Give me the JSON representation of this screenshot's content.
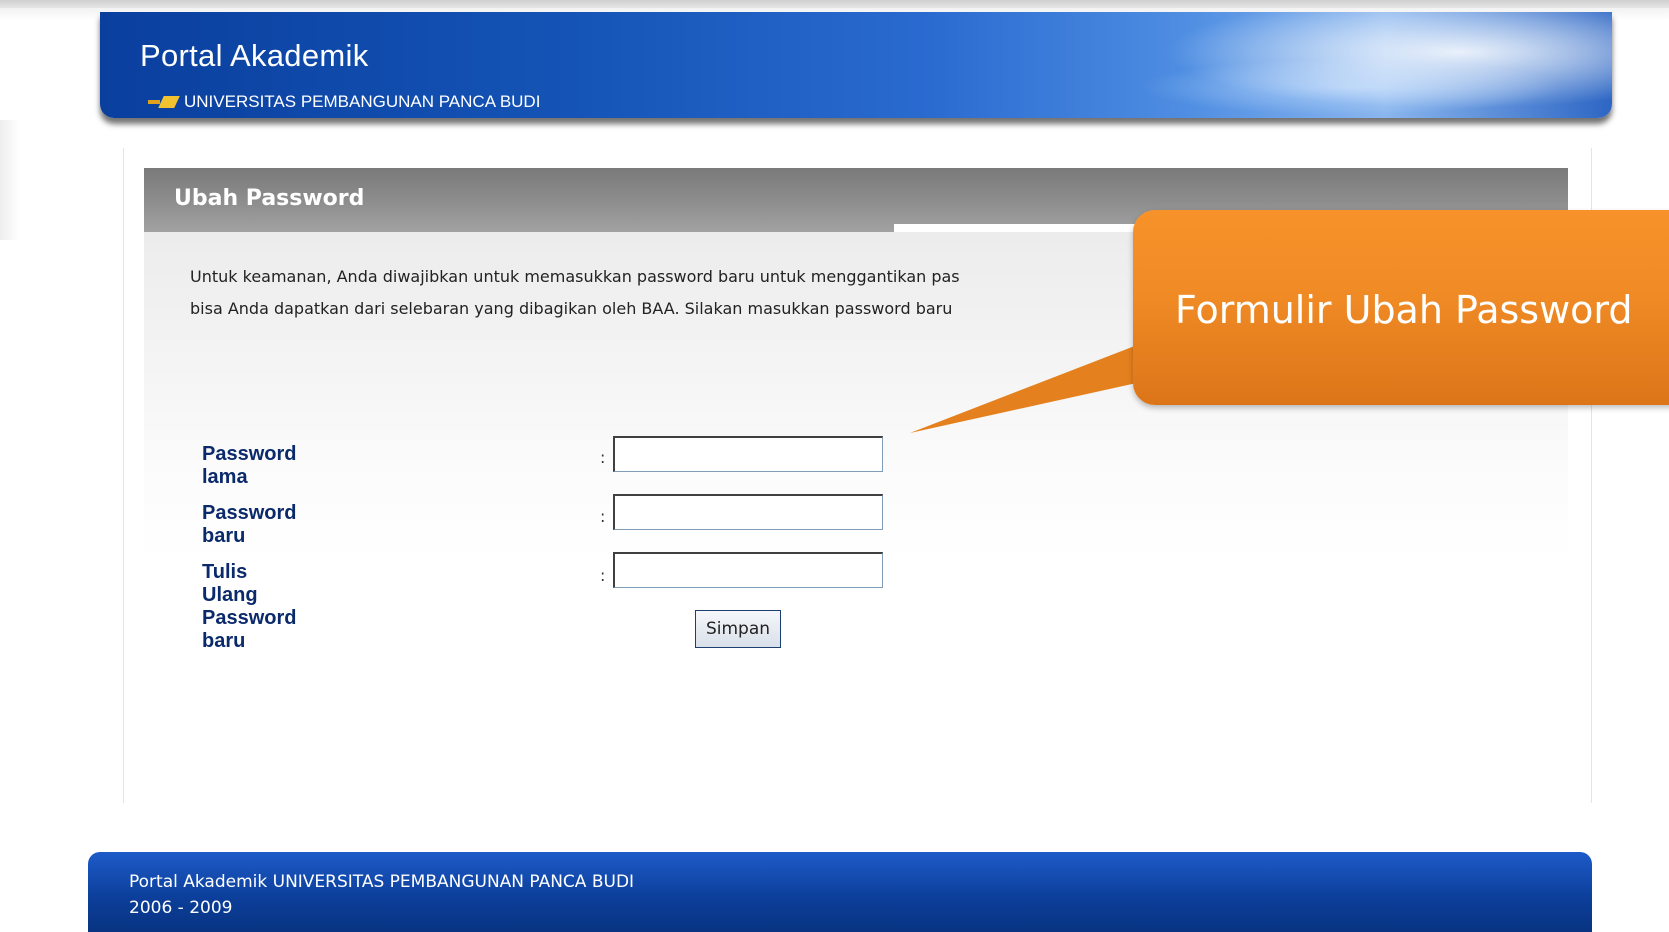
{
  "header": {
    "title": "Portal Akademik",
    "subtitle": "UNIVERSITAS PEMBANGUNAN PANCA BUDI"
  },
  "panel": {
    "title": "Ubah Password",
    "intro_line1": "Untuk keamanan, Anda diwajibkan untuk memasukkan password baru untuk menggantikan pas",
    "intro_line2": "bisa Anda dapatkan dari selebaran yang dibagikan oleh BAA. Silakan masukkan password baru"
  },
  "form": {
    "fields": [
      {
        "label": "Password lama",
        "colon": ":",
        "value": ""
      },
      {
        "label": "Password baru",
        "colon": ":",
        "value": ""
      },
      {
        "label": "Tulis Ulang Password baru",
        "colon": ":",
        "value": ""
      }
    ],
    "submit_label": "Simpan"
  },
  "footer": {
    "line1": "Portal Akademik UNIVERSITAS PEMBANGUNAN PANCA BUDI",
    "line2": "2006 - 2009"
  },
  "callout": {
    "text": "Formulir Ubah Password",
    "color": "#f18b26"
  },
  "colors": {
    "header_blue": "#1453b5",
    "label_navy": "#0b2a6b",
    "titlebar_gray": "#8c8c8c",
    "footer_blue": "#0c3f9b"
  }
}
